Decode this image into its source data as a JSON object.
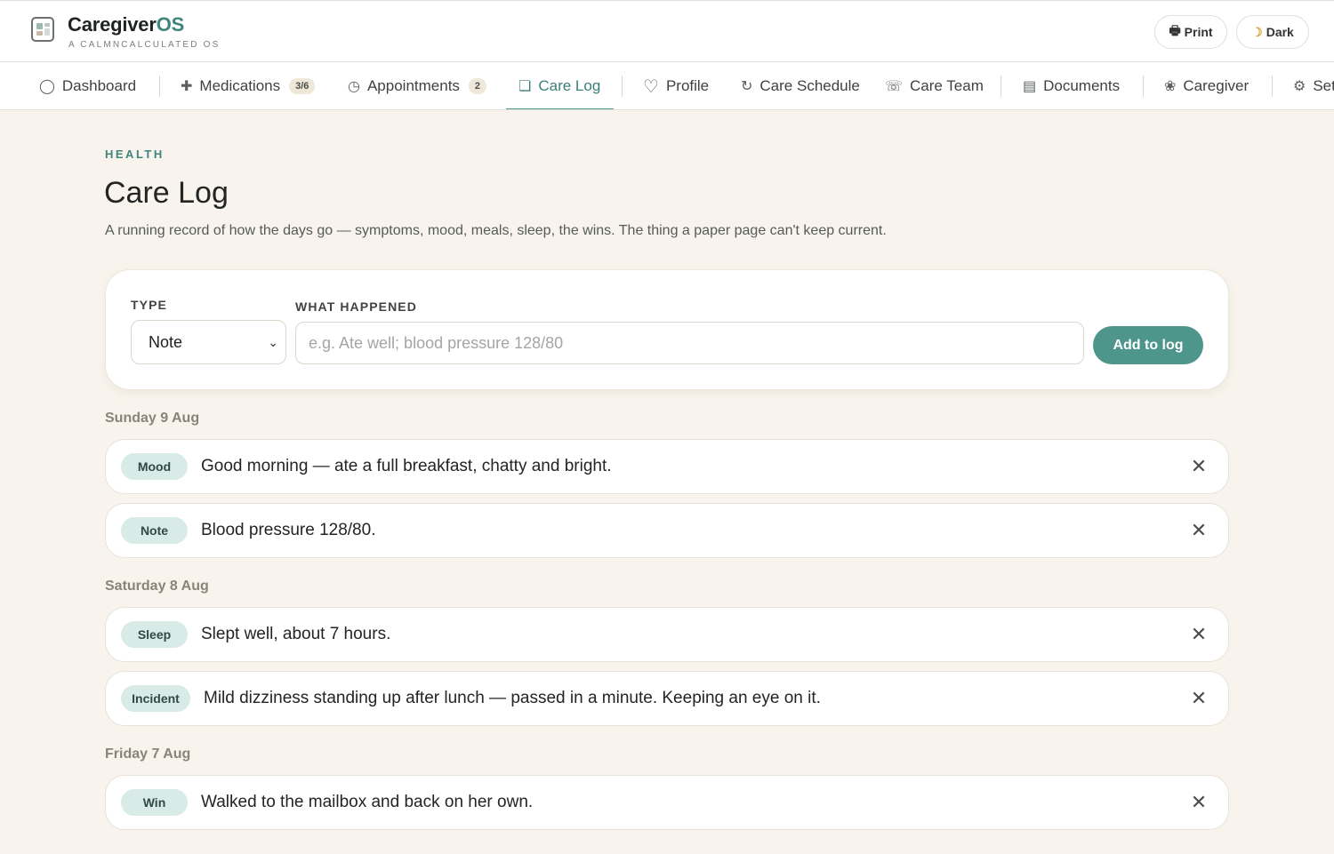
{
  "header": {
    "brand_main": "Caregiver",
    "brand_accent": "OS",
    "tagline": "A CALMNCALCULATED OS",
    "print_icon": "printer-icon",
    "print_label": "Print",
    "dark_icon": "moon-icon",
    "dark_label": "Dark"
  },
  "nav": {
    "tabs": [
      {
        "label": "Dashboard",
        "icon": "◯"
      },
      {
        "label": "Medications",
        "icon": "✚",
        "badge": "3/6"
      },
      {
        "label": "Appointments",
        "icon": "◷",
        "badge": "2"
      },
      {
        "label": "Care Log",
        "icon": "❏"
      },
      {
        "label": "Profile",
        "icon": "♡"
      },
      {
        "label": "Care Schedule",
        "icon": "↻"
      },
      {
        "label": "Care Team",
        "icon": "☏"
      },
      {
        "label": "Documents",
        "icon": "▤"
      },
      {
        "label": "Caregiver",
        "icon": "❀"
      },
      {
        "label": "Settings",
        "icon": "⚙"
      }
    ],
    "active": "Care Log"
  },
  "page": {
    "eyebrow": "HEALTH",
    "title": "Care Log",
    "subtitle": "A running record of how the days go — symptoms, mood, meals, sleep, the wins. The thing a paper page can't keep current."
  },
  "form": {
    "type_label": "TYPE",
    "type_value": "Note",
    "what_label": "WHAT HAPPENED",
    "what_placeholder": "e.g. Ate well; blood pressure 128/80",
    "submit_label": "Add to log"
  },
  "log": {
    "days": [
      {
        "date": "Sunday 9 Aug",
        "entries": [
          {
            "type": "Mood",
            "text": "Good morning — ate a full breakfast, chatty and bright."
          },
          {
            "type": "Note",
            "text": "Blood pressure 128/80."
          }
        ]
      },
      {
        "date": "Saturday 8 Aug",
        "entries": [
          {
            "type": "Sleep",
            "text": "Slept well, about 7 hours."
          },
          {
            "type": "Incident",
            "text": "Mild dizziness standing up after lunch — passed in a minute. Keeping an eye on it."
          }
        ]
      },
      {
        "date": "Friday 7 Aug",
        "entries": [
          {
            "type": "Win",
            "text": "Walked to the mailbox and back on her own."
          }
        ]
      }
    ],
    "delete_icon": "close-icon"
  },
  "colors": {
    "accent": "#4e958c",
    "background": "#f8f4ed",
    "pill": "#d9ebe7"
  }
}
